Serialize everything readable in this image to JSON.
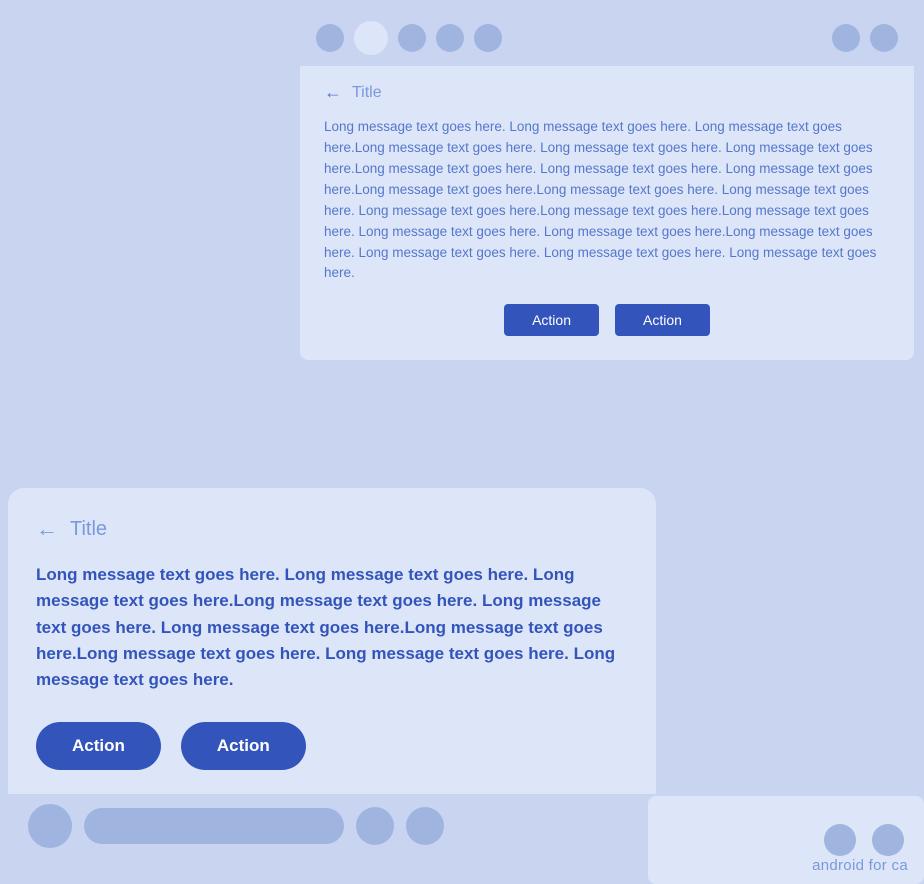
{
  "desktop": {
    "topbar": {
      "dots": [
        "inactive",
        "active",
        "inactive",
        "inactive",
        "inactive",
        "spacer",
        "inactive",
        "inactive"
      ]
    },
    "title": "Title",
    "body_text": "Long message text goes here. Long message text goes here. Long message text goes here.Long message text goes here. Long message text goes here. Long message text goes here.Long message text goes here. Long message text goes here. Long message text goes here.Long message text goes here.Long message text goes here. Long message text goes here. Long message text goes here.Long message text goes here.Long message text goes here. Long message text goes here. Long message text goes here.Long message text goes here. Long message text goes here. Long message text goes here. Long message text goes here.",
    "action1_label": "Action",
    "action2_label": "Action"
  },
  "mobile": {
    "title": "Title",
    "body_text": "Long message text goes here. Long message text goes here. Long message text goes here.Long message text goes here. Long message text goes here. Long message text goes here.Long message text goes here.Long message text goes here. Long message text goes here. Long message text goes here.",
    "action1_label": "Action",
    "action2_label": "Action"
  },
  "watermark": {
    "text": "android for ca"
  }
}
